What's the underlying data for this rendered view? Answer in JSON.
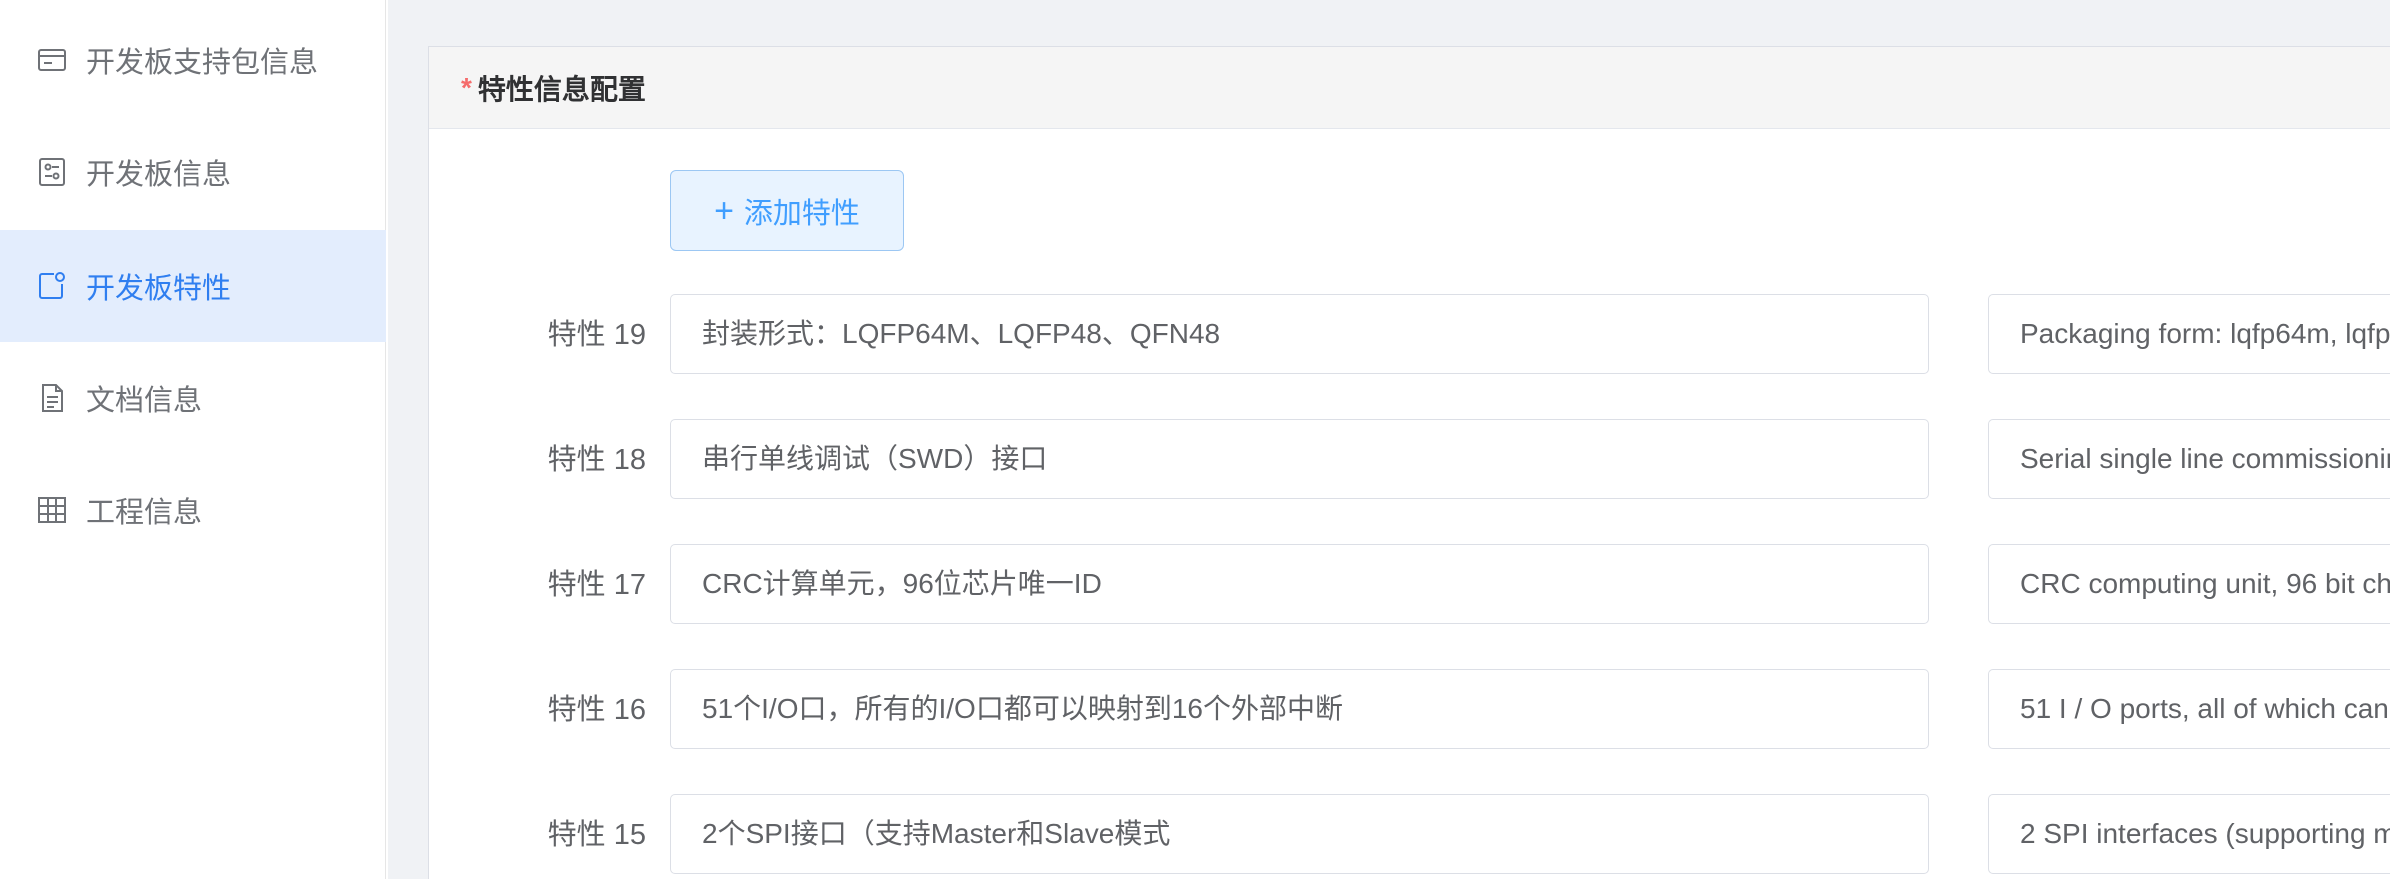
{
  "sidebar": {
    "items": [
      {
        "label": "开发板支持包信息",
        "icon": "card-icon",
        "active": false
      },
      {
        "label": "开发板信息",
        "icon": "settings-panel-icon",
        "active": false
      },
      {
        "label": "开发板特性",
        "icon": "feature-icon",
        "active": true
      },
      {
        "label": "文档信息",
        "icon": "document-icon",
        "active": false
      },
      {
        "label": "工程信息",
        "icon": "grid-table-icon",
        "active": false
      }
    ]
  },
  "panel": {
    "required_mark": "*",
    "title": "特性信息配置",
    "add_button_label": "添加特性",
    "add_button_icon": "plus-icon"
  },
  "features": [
    {
      "label": "特性 19",
      "cn": "封装形式：LQFP64M、LQFP48、QFN48",
      "en": "Packaging form: lqfp64m, lqfp"
    },
    {
      "label": "特性 18",
      "cn": "串行单线调试（SWD）接口",
      "en": "Serial single line commissionin"
    },
    {
      "label": "特性 17",
      "cn": "CRC计算单元，96位芯片唯一ID",
      "en": "CRC computing unit, 96 bit ch"
    },
    {
      "label": "特性 16",
      "cn": "51个I/O口，所有的I/O口都可以映射到16个外部中断",
      "en": "51 I / O ports, all of which can"
    },
    {
      "label": "特性 15",
      "cn": "2个SPI接口（支持Master和Slave模式",
      "en": "2 SPI interfaces (supporting m"
    }
  ],
  "colors": {
    "accent": "#409eff",
    "active_bg": "#e3edfd",
    "required": "#f56c6c"
  }
}
